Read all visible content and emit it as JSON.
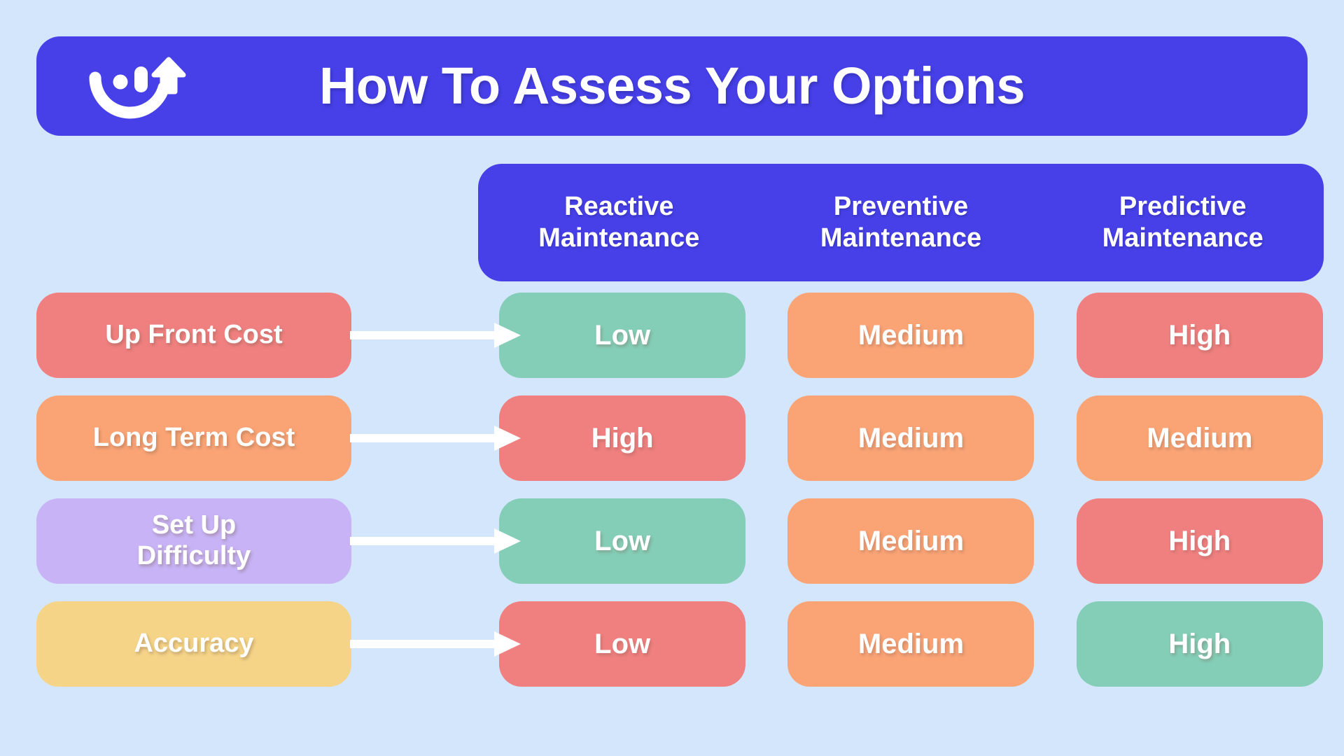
{
  "theme": {
    "background": "#d4e6fb",
    "brand_blue": "#4740e8",
    "green": "#84ceb7",
    "orange": "#faa476",
    "red": "#f08080",
    "purple": "#c7b3f5",
    "yellow": "#f5d488",
    "salmon": "#f08080",
    "white": "#ffffff"
  },
  "header": {
    "title": "How To Assess Your Options",
    "logo_icon": "smile-arrow-icon"
  },
  "chart_data": {
    "type": "table",
    "title": "How To Assess Your Options",
    "row_header_label": "",
    "categories": [
      "Reactive Maintenance",
      "Preventive Maintenance",
      "Predictive Maintenance"
    ],
    "rows": [
      "Up Front Cost",
      "Long Term Cost",
      "Set Up Difficulty",
      "Accuracy"
    ],
    "values": [
      [
        "Low",
        "Medium",
        "High"
      ],
      [
        "High",
        "Medium",
        "Medium"
      ],
      [
        "Low",
        "Medium",
        "High"
      ],
      [
        "Low",
        "Medium",
        "High"
      ]
    ],
    "value_colors": [
      [
        "#84ceb7",
        "#faa476",
        "#f08080"
      ],
      [
        "#f08080",
        "#faa476",
        "#faa476"
      ],
      [
        "#84ceb7",
        "#faa476",
        "#f08080"
      ],
      [
        "#f08080",
        "#faa476",
        "#84ceb7"
      ]
    ],
    "row_colors": [
      "#f08080",
      "#faa476",
      "#c7b3f5",
      "#f5d488"
    ]
  },
  "columns": [
    {
      "line1": "Reactive",
      "line2": "Maintenance"
    },
    {
      "line1": "Preventive",
      "line2": "Maintenance"
    },
    {
      "line1": "Predictive",
      "line2": "Maintenance"
    }
  ],
  "rows": [
    {
      "label": "Up Front Cost",
      "label_line1": "Up Front Cost",
      "label_line2": "",
      "label_color": "#f08080",
      "cells": [
        {
          "value": "Low",
          "color": "#84ceb7"
        },
        {
          "value": "Medium",
          "color": "#faa476"
        },
        {
          "value": "High",
          "color": "#f08080"
        }
      ]
    },
    {
      "label": "Long Term Cost",
      "label_line1": "Long Term Cost",
      "label_line2": "",
      "label_color": "#faa476",
      "cells": [
        {
          "value": "High",
          "color": "#f08080"
        },
        {
          "value": "Medium",
          "color": "#faa476"
        },
        {
          "value": "Medium",
          "color": "#faa476"
        }
      ]
    },
    {
      "label": "Set Up Difficulty",
      "label_line1": "Set Up",
      "label_line2": "Difficulty",
      "label_color": "#c7b3f5",
      "cells": [
        {
          "value": "Low",
          "color": "#84ceb7"
        },
        {
          "value": "Medium",
          "color": "#faa476"
        },
        {
          "value": "High",
          "color": "#f08080"
        }
      ]
    },
    {
      "label": "Accuracy",
      "label_line1": "Accuracy",
      "label_line2": "",
      "label_color": "#f5d488",
      "cells": [
        {
          "value": "Low",
          "color": "#f08080"
        },
        {
          "value": "Medium",
          "color": "#faa476"
        },
        {
          "value": "High",
          "color": "#84ceb7"
        }
      ]
    }
  ]
}
